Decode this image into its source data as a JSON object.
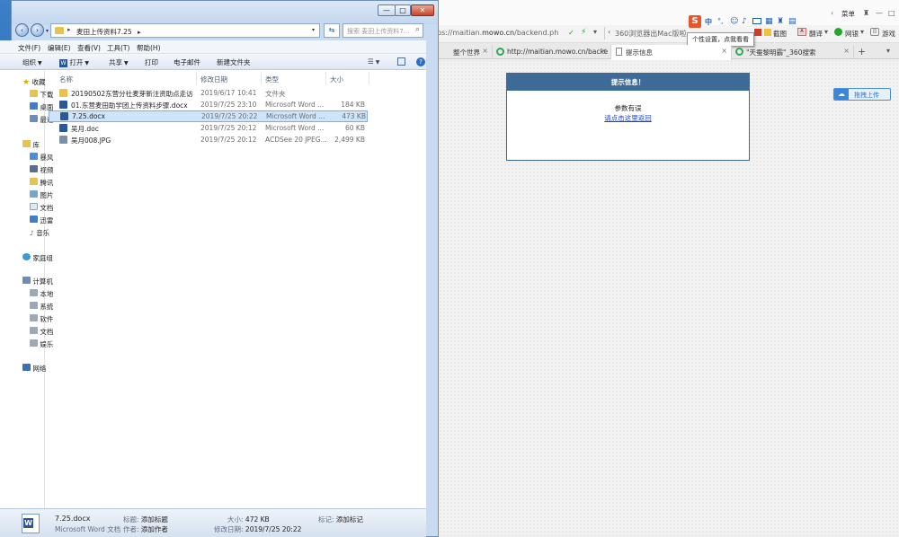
{
  "explorer": {
    "breadcrumb": "麦田上传资料7.25",
    "search_placeholder": "搜索 麦田上传资料7...",
    "menu": [
      "文件(F)",
      "编辑(E)",
      "查看(V)",
      "工具(T)",
      "帮助(H)"
    ],
    "toolbar": {
      "organize": "组织",
      "open": "打开",
      "share": "共享",
      "print": "打印",
      "email": "电子邮件",
      "new_folder": "新建文件夹"
    },
    "columns": {
      "name": "名称",
      "date": "修改日期",
      "type": "类型",
      "size": "大小"
    },
    "nav": {
      "favorites": "收藏",
      "fav_items": [
        "下载",
        "桌面",
        "最近"
      ],
      "libraries": "库",
      "lib_items": [
        "暴风",
        "视频",
        "腾讯",
        "图片",
        "文档",
        "迅雷",
        "音乐"
      ],
      "homegroup": "家庭组",
      "computer": "计算机",
      "comp_items": [
        "本地",
        "系统",
        "软件",
        "文档",
        "娱乐"
      ],
      "network": "网络"
    },
    "files": [
      {
        "name": "20190502东营分社麦芽新注资助点走访...",
        "date": "2019/6/17 10:41",
        "type": "文件夹",
        "size": "",
        "icon": "folder-icon"
      },
      {
        "name": "01.东营麦田助学团上传资料步骤.docx",
        "date": "2019/7/25 23:10",
        "type": "Microsoft Word ...",
        "size": "184 KB",
        "icon": "word-icon"
      },
      {
        "name": "7.25.docx",
        "date": "2019/7/25 20:22",
        "type": "Microsoft Word ...",
        "size": "473 KB",
        "icon": "word-icon",
        "selected": true
      },
      {
        "name": "吴月.doc",
        "date": "2019/7/25 20:12",
        "type": "Microsoft Word ...",
        "size": "60 KB",
        "icon": "word-icon"
      },
      {
        "name": "吴月008.JPG",
        "date": "2019/7/25 20:12",
        "type": "ACDSee 20 JPEG...",
        "size": "2,499 KB",
        "icon": "image-icon"
      }
    ],
    "details": {
      "filename": "7.25.docx",
      "filetype": "Microsoft Word 文档",
      "title_key": "标题:",
      "title_val": "添加标题",
      "author_key": "作者:",
      "author_val": "添加作者",
      "size_key": "大小:",
      "size_val": "472 KB",
      "modified_key": "修改日期:",
      "modified_val": "2019/7/25 20:22",
      "tags_key": "标记:",
      "tags_val": "添加标记"
    }
  },
  "browser": {
    "address_prefix": "ps://maitian.",
    "address_domain": "mowo.cn",
    "address_suffix": "/backend.ph",
    "search_hint": "360浏览器出Mac版啦",
    "toolbar_right": [
      "翻译",
      "网银",
      "游戏"
    ],
    "screenshot_label": "截图",
    "home_label": "菜单",
    "tooltip": "个性设置，点我看看",
    "tabs": [
      {
        "label": "整个世界"
      },
      {
        "label": "http://maitian.mowo.cn/backe"
      },
      {
        "label": "提示信息",
        "active": true
      },
      {
        "label": "\"天蚕黎明霸\"_360搜索"
      }
    ],
    "notice": {
      "title": "提示信息！",
      "message": "参数有误",
      "link": "请点击这里返回"
    },
    "upload_button": "拖拽上传"
  },
  "colors": {
    "accent": "#3e6a98",
    "link": "#1a3fd6",
    "selection": "#cde4fb"
  }
}
